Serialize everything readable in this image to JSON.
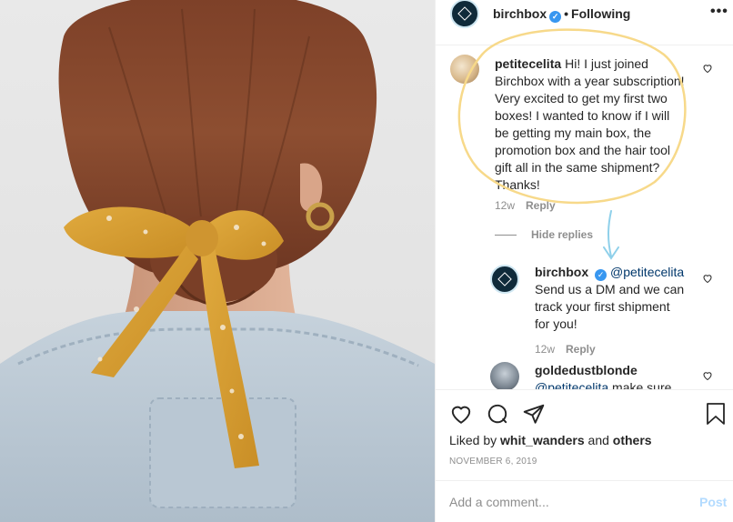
{
  "post": {
    "username": "birchbox",
    "separator": "•",
    "follow_state": "Following",
    "more_icon": "more-options-icon",
    "image_alt": "Woman with auburn hair in a low bun tied with a mustard floral silk scarf bow, wearing gold hoop earrings and a denim jacket"
  },
  "comments": [
    {
      "username": "petitecelita",
      "text": "Hi! I just joined Birchbox with a year subscription! Very excited to get my first two boxes! I wanted to know if I will be getting my main box, the promotion box and the hair tool gift all in the same shipment? Thanks!",
      "lines": [
        "Hi! I just joined",
        "Birchbox with a year subscription!",
        "Very excited to get my first two",
        "boxes! I wanted to know if I will",
        "be getting my main box, the",
        "promotion box and the hair tool",
        "gift all in the same shipment?",
        "Thanks!"
      ],
      "age": "12w",
      "reply_label": "Reply",
      "hide_replies_label": "Hide replies"
    },
    {
      "username": "birchbox",
      "mention": "@petitecelita",
      "lines": [
        "Send us a DM and we can",
        "track your first shipment",
        "for you!"
      ],
      "age": "12w",
      "reply_label": "Reply"
    },
    {
      "username": "goldedustblonde",
      "mention": "@petitecelita",
      "partial_text": "make sure"
    }
  ],
  "actions": {
    "like_icon": "heart-icon",
    "comment_icon": "comment-icon",
    "share_icon": "share-icon",
    "save_icon": "bookmark-icon"
  },
  "likes": {
    "prefix": "Liked by",
    "user": "whit_wanders",
    "and": "and",
    "others": "others"
  },
  "date": "NOVEMBER 6, 2019",
  "add_comment": {
    "placeholder": "Add a comment...",
    "post_label": "Post"
  },
  "colors": {
    "verified": "#3897f0",
    "annotation": "#f7d98a",
    "annotation_arrow": "#8fd0ea",
    "post_disabled": "#b3dbff",
    "meta_gray": "#8e8e8e",
    "scarf": "#d9a43a",
    "hair": "#8a4a2e"
  }
}
